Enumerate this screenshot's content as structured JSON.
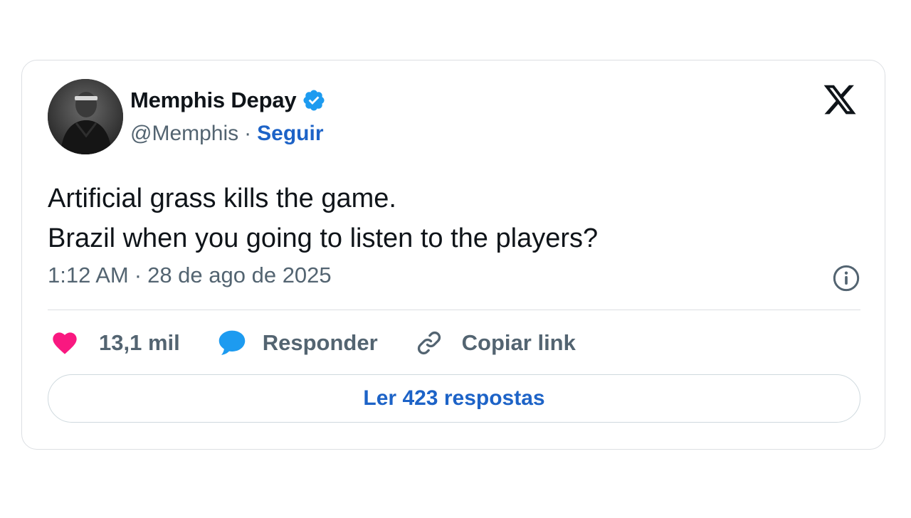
{
  "tweet": {
    "author": {
      "display_name": "Memphis Depay",
      "handle": "@Memphis",
      "verified": true,
      "verified_color": "#1d9bf0"
    },
    "follow_label": "Seguir",
    "separator": "·",
    "text_lines": [
      "Artificial grass kills the game.",
      "Brazil when you going to listen to the players?"
    ],
    "time": "1:12 AM",
    "date": "28 de ago de 2025",
    "logo_icon": "x-logo-icon",
    "info_icon": "info-icon"
  },
  "actions": {
    "like": {
      "icon": "heart-icon",
      "count": "13,1 mil",
      "color": "#f91880"
    },
    "reply": {
      "icon": "speech-bubble-icon",
      "label": "Responder",
      "color": "#1d9bf0"
    },
    "copy": {
      "icon": "link-icon",
      "label": "Copiar link"
    }
  },
  "read_replies_label": "Ler 423 respostas",
  "colors": {
    "accent": "#1d63c7",
    "muted_text": "#536471",
    "border": "#dcdfe3"
  }
}
